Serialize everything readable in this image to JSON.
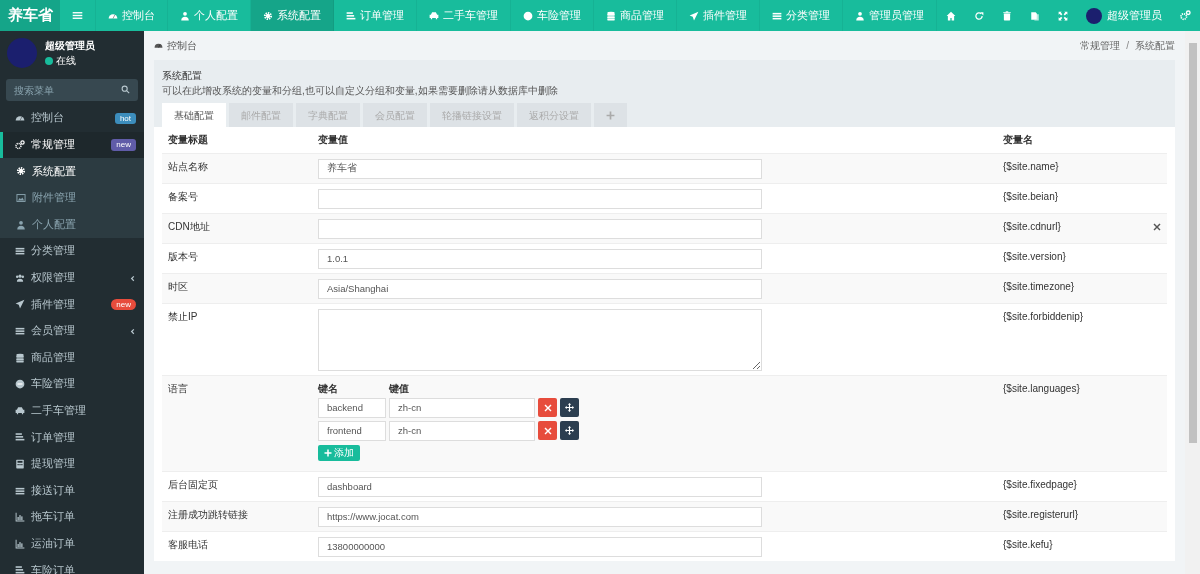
{
  "brand": "养车省",
  "topnav": {
    "items": [
      {
        "label": "控制台",
        "selected": false
      },
      {
        "label": "个人配置",
        "selected": false
      },
      {
        "label": "系统配置",
        "selected": true
      },
      {
        "label": "订单管理",
        "selected": false
      },
      {
        "label": "二手车管理",
        "selected": false
      },
      {
        "label": "车险管理",
        "selected": false
      },
      {
        "label": "商品管理",
        "selected": false
      },
      {
        "label": "插件管理",
        "selected": false
      },
      {
        "label": "分类管理",
        "selected": false
      },
      {
        "label": "管理员管理",
        "selected": false
      }
    ],
    "user": "超级管理员"
  },
  "sidebar": {
    "user": {
      "name": "超级管理员",
      "status": "在线"
    },
    "search": {
      "placeholder": "搜索菜单"
    },
    "items": [
      {
        "label": "控制台",
        "selected": false,
        "badge": {
          "text": "hot",
          "color": "#3c8dbc"
        }
      },
      {
        "label": "常规管理",
        "selected": true,
        "expanded": true,
        "badge": {
          "text": "new",
          "color": "#605ca8"
        },
        "children": [
          {
            "label": "系统配置",
            "selected": true
          },
          {
            "label": "附件管理",
            "selected": false
          },
          {
            "label": "个人配置",
            "selected": false
          }
        ]
      },
      {
        "label": "分类管理",
        "selected": false
      },
      {
        "label": "权限管理",
        "selected": false,
        "expanded": false
      },
      {
        "label": "插件管理",
        "selected": false,
        "badge": {
          "text": "new",
          "color": "#e74c3c"
        }
      },
      {
        "label": "会员管理",
        "selected": false,
        "expanded": false
      },
      {
        "label": "商品管理",
        "selected": false
      },
      {
        "label": "车险管理",
        "selected": false
      },
      {
        "label": "二手车管理",
        "selected": false
      },
      {
        "label": "订单管理",
        "selected": false
      },
      {
        "label": "提现管理",
        "selected": false
      },
      {
        "label": "接送订单",
        "selected": false
      },
      {
        "label": "拖车订单",
        "selected": false
      },
      {
        "label": "运油订单",
        "selected": false
      },
      {
        "label": "车险订单",
        "selected": false
      }
    ]
  },
  "breadcrumb": {
    "home": "控制台",
    "trail": [
      "常规管理",
      "系统配置"
    ],
    "separator": "/"
  },
  "panel": {
    "title": "系统配置",
    "description": "可以在此增改系统的变量和分组,也可以自定义分组和变量,如果需要删除请从数据库中删除",
    "tabs": [
      {
        "label": "基础配置",
        "selected": true
      },
      {
        "label": "邮件配置",
        "selected": false
      },
      {
        "label": "字典配置",
        "selected": false
      },
      {
        "label": "会员配置",
        "selected": false
      },
      {
        "label": "轮播链接设置",
        "selected": false
      },
      {
        "label": "返积分设置",
        "selected": false
      }
    ]
  },
  "table": {
    "columns": [
      "变量标题",
      "变量值",
      "变量名"
    ],
    "rows": [
      {
        "kind": "input",
        "title": "站点名称",
        "value": "养车省",
        "variable": "{$site.name}",
        "delete_shown": false
      },
      {
        "kind": "input",
        "title": "备案号",
        "value": "",
        "variable": "{$site.beian}",
        "delete_shown": false
      },
      {
        "kind": "input",
        "title": "CDN地址",
        "value": "",
        "variable": "{$site.cdnurl}",
        "delete_shown": true
      },
      {
        "kind": "input",
        "title": "版本号",
        "value": "1.0.1",
        "variable": "{$site.version}",
        "delete_shown": false
      },
      {
        "kind": "input",
        "title": "时区",
        "value": "Asia/Shanghai",
        "variable": "{$site.timezone}",
        "delete_shown": false
      },
      {
        "kind": "textarea",
        "title": "禁止IP",
        "value": "",
        "variable": "{$site.forbiddenip}",
        "delete_shown": false
      },
      {
        "kind": "keyvalue",
        "title": "语言",
        "key_header": "键名",
        "value_header": "键值",
        "pairs": [
          {
            "key": "backend",
            "value": "zh-cn"
          },
          {
            "key": "frontend",
            "value": "zh-cn"
          }
        ],
        "add_label": "添加",
        "variable": "{$site.languages}",
        "delete_shown": false
      },
      {
        "kind": "input",
        "title": "后台固定页",
        "value": "dashboard",
        "variable": "{$site.fixedpage}",
        "delete_shown": false
      },
      {
        "kind": "input",
        "title": "注册成功跳转链接",
        "value": "https://www.jocat.com",
        "variable": "{$site.registerurl}",
        "delete_shown": false
      },
      {
        "kind": "input",
        "title": "客服电话",
        "value": "13800000000",
        "variable": "{$site.kefu}",
        "delete_shown": false
      }
    ]
  }
}
